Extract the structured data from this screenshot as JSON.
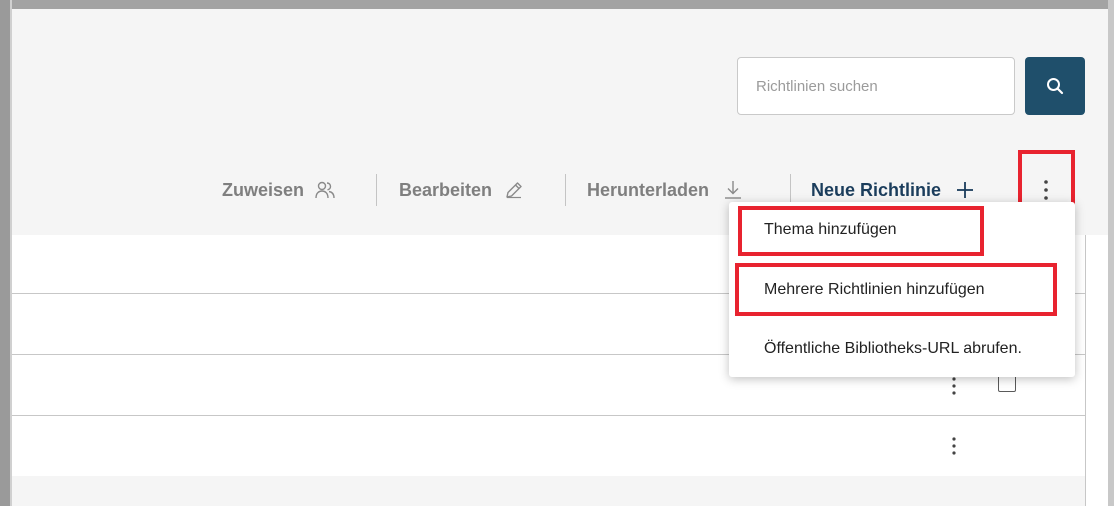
{
  "search": {
    "placeholder": "Richtlinien suchen",
    "button_icon": "search-icon"
  },
  "toolbar": {
    "assign_label": "Zuweisen",
    "assign_icon": "users-icon",
    "edit_label": "Bearbeiten",
    "edit_icon": "pencil-icon",
    "download_label": "Herunterladen",
    "download_icon": "download-icon",
    "new_policy_label": "Neue Richtlinie",
    "new_policy_icon": "plus-icon",
    "more_icon": "kebab-menu-icon"
  },
  "dropdown_menu": {
    "items": [
      {
        "label": "Thema hinzufügen"
      },
      {
        "label": "Mehrere Richtlinien hinzufügen"
      },
      {
        "label": "Öffentliche Bibliotheks-URL abrufen."
      }
    ]
  },
  "colors": {
    "primary": "#1f4f6b",
    "primary_text": "#1b3d5c",
    "muted_text": "#7f7f7f",
    "highlight": "#e8232f",
    "header_bg": "#f5f5f5"
  }
}
